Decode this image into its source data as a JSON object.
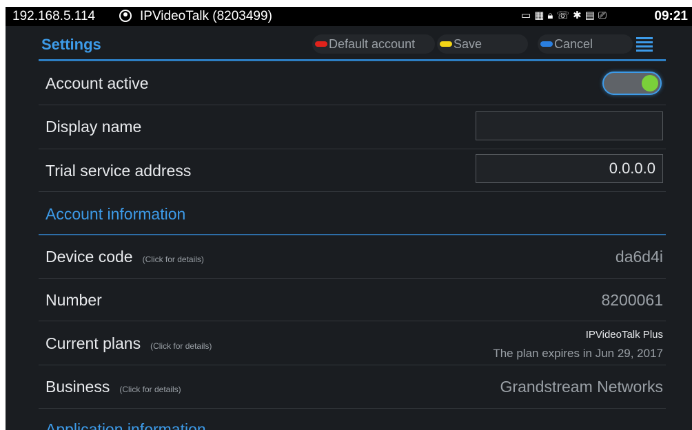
{
  "statusbar": {
    "ip": "192.168.5.114",
    "account": "IPVideoTalk (8203499)",
    "icons": [
      "screen-icon",
      "sim-icon",
      "lock-icon",
      "call-icon",
      "bluetooth-icon",
      "storage-icon",
      "cast-icon"
    ],
    "time": "09:21"
  },
  "header": {
    "title": "Settings",
    "default_account": "Default account",
    "save": "Save",
    "cancel": "Cancel",
    "accent": "#3d9be9",
    "red": "#e0231c",
    "yellow": "#f2d416",
    "blue": "#2a7fe0"
  },
  "rows": {
    "account_active": {
      "label": "Account active",
      "toggle_on": true
    },
    "display_name": {
      "label": "Display name",
      "value": ""
    },
    "trial_service": {
      "label": "Trial service address",
      "value": "0.0.0.0"
    }
  },
  "account_info": {
    "section_title": "Account information",
    "device_code": {
      "label": "Device code",
      "hint": "(Click for details)",
      "value": "da6d4i"
    },
    "number": {
      "label": "Number",
      "value": "8200061"
    },
    "current_plans": {
      "label": "Current plans",
      "hint": "(Click for details)",
      "plan": "IPVideoTalk Plus",
      "expires": "The plan expires in Jun 29, 2017"
    },
    "business": {
      "label": "Business",
      "hint": "(Click for details)",
      "value": "Grandstream Networks"
    }
  },
  "next_section": {
    "title": "Application information"
  }
}
